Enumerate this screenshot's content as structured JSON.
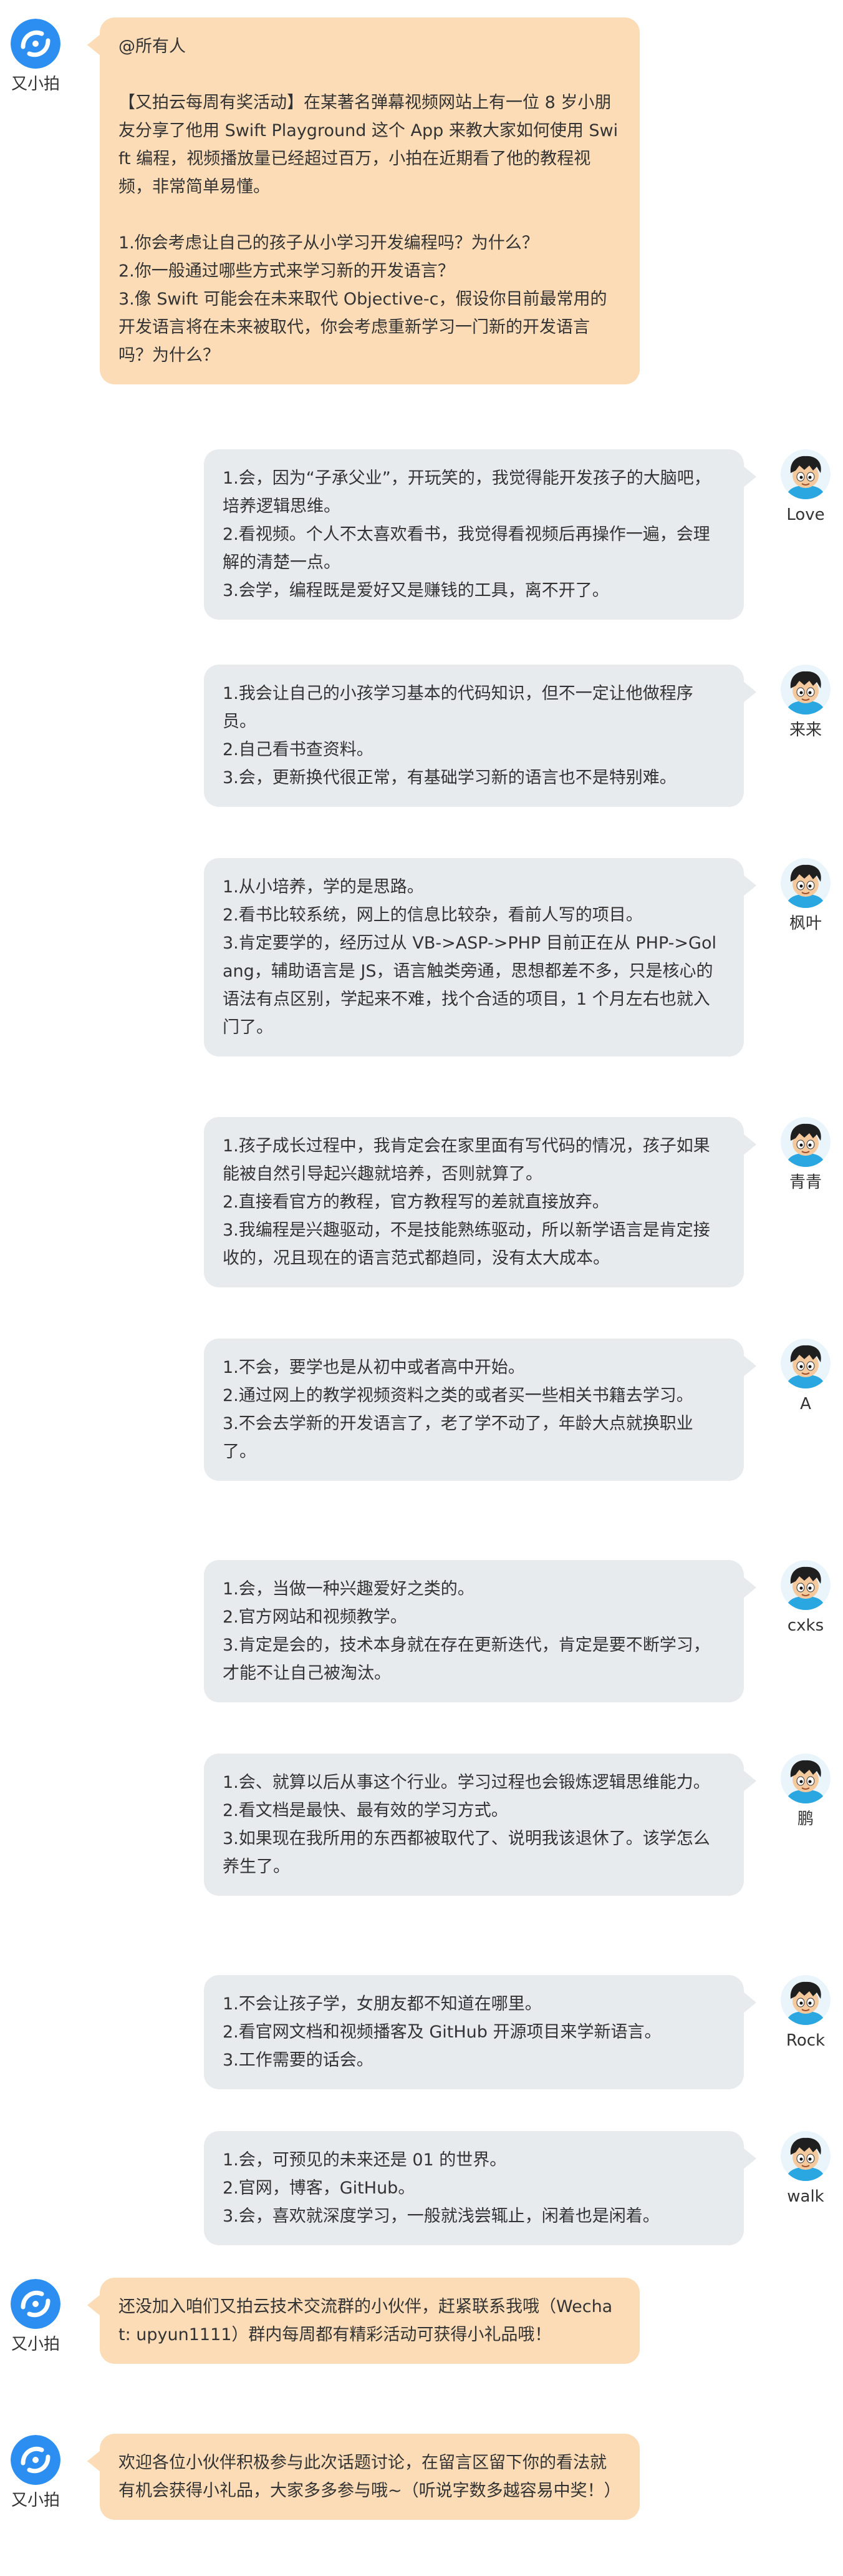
{
  "bot": {
    "name": "又小拍",
    "avatar_icon": "upyun-logo-icon",
    "bubble_color": "#fcdcb6",
    "avatar_color": "#2b8ef0"
  },
  "users": {
    "bubble_color": "#e8ebee",
    "avatar_icon": "cartoon-boy-avatar-icon"
  },
  "messages": [
    {
      "side": "left",
      "name": "又小拍",
      "lines": [
        "@所有人",
        "",
        "【又拍云每周有奖活动】在某著名弹幕视频网站上有一位 8 岁小朋友分享了他用 Swift Playground 这个 App 来教大家如何使用 Swift 编程，视频播放量已经超过百万，小拍在近期看了他的教程视频，非常简单易懂。",
        "",
        "1.你会考虑让自己的孩子从小学习开发编程吗？为什么？",
        "2.你一般通过哪些方式来学习新的开发语言？",
        "3.像 Swift 可能会在未来取代 Objective-c，假设你目前最常用的开发语言将在未来被取代，你会考虑重新学习一门新的开发语言吗？为什么？"
      ]
    },
    {
      "side": "right",
      "name": "Love",
      "lines": [
        "1.会，因为“子承父业”，开玩笑的，我觉得能开发孩子的大脑吧，培养逻辑思维。",
        "2.看视频。个人不太喜欢看书，我觉得看视频后再操作一遍，会理解的清楚一点。",
        "3.会学，编程既是爱好又是赚钱的工具，离不开了。"
      ]
    },
    {
      "side": "right",
      "name": "来来",
      "lines": [
        "1.我会让自己的小孩学习基本的代码知识，但不一定让他做程序员。",
        "2.自己看书查资料。",
        "3.会，更新换代很正常，有基础学习新的语言也不是特别难。"
      ]
    },
    {
      "side": "right",
      "name": "枫叶",
      "lines": [
        "1.从小培养，学的是思路。",
        "2.看书比较系统，网上的信息比较杂，看前人写的项目。",
        "3.肯定要学的，经历过从 VB->ASP->PHP 目前正在从 PHP->Golang，辅助语言是 JS，语言触类旁通，思想都差不多，只是核心的语法有点区别，学起来不难，找个合适的项目，1 个月左右也就入门了。"
      ]
    },
    {
      "side": "right",
      "name": "青青",
      "lines": [
        "1.孩子成长过程中，我肯定会在家里面有写代码的情况，孩子如果能被自然引导起兴趣就培养，否则就算了。",
        "2.直接看官方的教程，官方教程写的差就直接放弃。",
        "3.我编程是兴趣驱动，不是技能熟练驱动，所以新学语言是肯定接收的，况且现在的语言范式都趋同，没有太大成本。"
      ]
    },
    {
      "side": "right",
      "name": "A",
      "lines": [
        "1.不会，要学也是从初中或者高中开始。",
        "2.通过网上的教学视频资料之类的或者买一些相关书籍去学习。",
        "3.不会去学新的开发语言了，老了学不动了，年龄大点就换职业了。"
      ]
    },
    {
      "side": "right",
      "name": "cxks",
      "lines": [
        "1.会，当做一种兴趣爱好之类的。",
        "2.官方网站和视频教学。",
        "3.肯定是会的，技术本身就在存在更新迭代，肯定是要不断学习，才能不让自己被淘汰。"
      ]
    },
    {
      "side": "right",
      "name": "鹏",
      "lines": [
        "1.会、就算以后从事这个行业。学习过程也会锻炼逻辑思维能力。",
        "2.看文档是最快、最有效的学习方式。",
        "3.如果现在我所用的东西都被取代了、说明我该退休了。该学怎么养生了。"
      ]
    },
    {
      "side": "right",
      "name": "Rock",
      "lines": [
        "1.不会让孩子学，女朋友都不知道在哪里。",
        "2.看官网文档和视频播客及 GitHub 开源项目来学新语言。",
        "3.工作需要的话会。"
      ]
    },
    {
      "side": "right",
      "name": "walk",
      "lines": [
        "1.会，可预见的未来还是 01 的世界。",
        "2.官网，博客，GitHub。",
        "3.会，喜欢就深度学习，一般就浅尝辄止，闲着也是闲着。"
      ]
    },
    {
      "side": "left",
      "name": "又小拍",
      "lines": [
        "还没加入咱们又拍云技术交流群的小伙伴，赶紧联系我哦（Wechat: upyun1111）群内每周都有精彩活动可获得小礼品哦！"
      ]
    },
    {
      "side": "left",
      "name": "又小拍",
      "lines": [
        "欢迎各位小伙伴积极参与此次话题讨论，在留言区留下你的看法就有机会获得小礼品，大家多多参与哦~（听说字数多越容易中奖！）"
      ]
    }
  ]
}
